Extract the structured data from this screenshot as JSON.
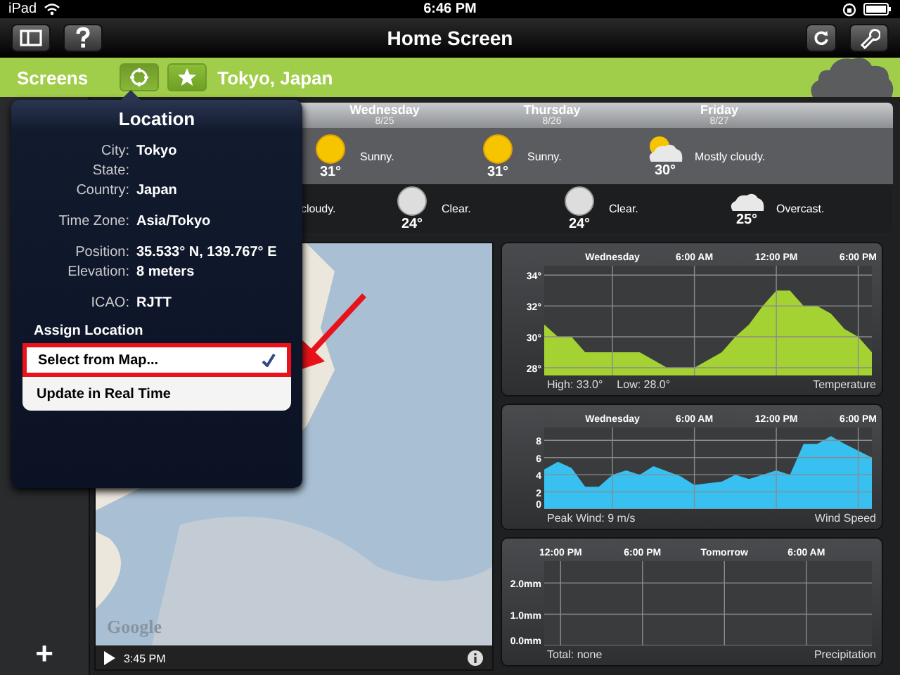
{
  "status_bar": {
    "device": "iPad",
    "time": "6:46 PM"
  },
  "nav_bar": {
    "title": "Home Screen"
  },
  "location_bar": {
    "screens_label": "Screens",
    "location": "Tokyo, Japan"
  },
  "forecast": {
    "days": [
      {
        "name": "Wednesday",
        "date": "8/25",
        "kind": "sun",
        "temp": "31°",
        "desc": "Sunny."
      },
      {
        "name": "Thursday",
        "date": "8/26",
        "kind": "sun",
        "temp": "31°",
        "desc": "Sunny."
      },
      {
        "name": "Friday",
        "date": "8/27",
        "kind": "partly-cloudy",
        "temp": "30°",
        "desc": "Mostly cloudy."
      }
    ],
    "nights": [
      {
        "kind": "partial",
        "desc": "cloudy."
      },
      {
        "kind": "moon",
        "temp": "24°",
        "desc": "Clear."
      },
      {
        "kind": "moon",
        "temp": "24°",
        "desc": "Clear."
      },
      {
        "kind": "cloud",
        "temp": "25°",
        "desc": "Overcast."
      }
    ]
  },
  "map": {
    "logo": "Google",
    "time": "3:45 PM"
  },
  "charts": [
    {
      "footer_left": [
        "High: 33.0°",
        "Low: 28.0°"
      ],
      "color": "#a4d233",
      "chart_data": {
        "type": "area",
        "title": "Temperature",
        "grid": true,
        "xlim": [
          -5,
          19
        ],
        "ylim": [
          27.5,
          34.6
        ],
        "xticks": [
          {
            "value": 0,
            "label": "Wednesday"
          },
          {
            "value": 6,
            "label": "6:00 AM"
          },
          {
            "value": 12,
            "label": "12:00 PM"
          },
          {
            "value": 18,
            "label": "6:00 PM"
          }
        ],
        "yticks": [
          {
            "value": 28,
            "label": "28°"
          },
          {
            "value": 30,
            "label": "30°"
          },
          {
            "value": 32,
            "label": "32°"
          },
          {
            "value": 34,
            "label": "34°"
          }
        ],
        "x": [
          -5,
          -4,
          -3,
          -2,
          -1,
          0,
          1,
          2,
          3,
          4,
          5,
          6,
          7,
          8,
          9,
          10,
          11,
          12,
          13,
          14,
          15,
          16,
          17,
          18,
          19
        ],
        "values": [
          30.8,
          30,
          30,
          29,
          29,
          29,
          29,
          29,
          28.5,
          28,
          28,
          28,
          28.5,
          29,
          30,
          30.8,
          32,
          33,
          33,
          32,
          32,
          31.5,
          30.5,
          30,
          29
        ]
      }
    },
    {
      "footer_left": [
        "Peak Wind: 9 m/s"
      ],
      "color": "#38c0f0",
      "chart_data": {
        "type": "area",
        "title": "Wind Speed",
        "grid": true,
        "xlim": [
          -5,
          19
        ],
        "ylim": [
          0,
          9.5
        ],
        "xticks": [
          {
            "value": 0,
            "label": "Wednesday"
          },
          {
            "value": 6,
            "label": "6:00 AM"
          },
          {
            "value": 12,
            "label": "12:00 PM"
          },
          {
            "value": 18,
            "label": "6:00 PM"
          }
        ],
        "yticks": [
          0,
          2,
          4,
          6,
          8
        ],
        "x": [
          -5,
          -4,
          -3,
          -2,
          -1,
          0,
          1,
          2,
          3,
          4,
          5,
          6,
          7,
          8,
          9,
          10,
          11,
          12,
          13,
          14,
          15,
          16,
          17,
          18,
          19
        ],
        "values": [
          4.6,
          5.5,
          4.8,
          2.6,
          2.6,
          4,
          4.5,
          4,
          5,
          4.4,
          3.8,
          2.8,
          3,
          3.2,
          4,
          3.5,
          4,
          4.5,
          4,
          7.6,
          7.6,
          8.5,
          7.6,
          6.8,
          6
        ]
      }
    },
    {
      "footer_left": [
        "Total: none"
      ],
      "chart_data": {
        "type": "area",
        "title": "Precipitation",
        "grid": true,
        "ylim": [
          0,
          2.7
        ],
        "categories": [
          "12:00 PM",
          "6:00 PM",
          "Tomorrow",
          "6:00 AM"
        ],
        "yticks": [
          {
            "value": 0,
            "label": "0.0mm"
          },
          {
            "value": 1,
            "label": "1.0mm"
          },
          {
            "value": 2,
            "label": "2.0mm"
          }
        ]
      }
    }
  ],
  "popover": {
    "title": "Location",
    "field_groups": [
      [
        {
          "label": "City:",
          "value": "Tokyo"
        },
        {
          "label": "State:"
        },
        {
          "label": "Country:",
          "value": "Japan"
        }
      ],
      [
        {
          "label": "Time Zone:",
          "value": "Asia/Tokyo"
        }
      ],
      [
        {
          "label": "Position:",
          "value": "35.533° N, 139.767° E"
        },
        {
          "label": "Elevation:",
          "value": "8 meters"
        }
      ],
      [
        {
          "label": "ICAO:",
          "value": "RJTT"
        }
      ]
    ],
    "section": "Assign Location",
    "options": [
      {
        "label": "Select from Map...",
        "checked": true,
        "highlighted": true
      },
      {
        "label": "Update in Real Time",
        "checked": false,
        "highlighted": false
      }
    ]
  },
  "sidebar": {
    "add": "+"
  }
}
